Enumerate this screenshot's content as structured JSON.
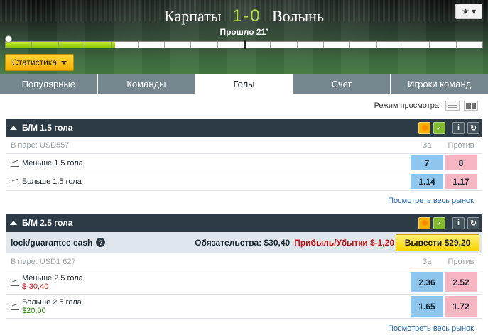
{
  "match": {
    "home_team": "Карпаты",
    "away_team": "Волынь",
    "score": "1-0",
    "elapsed": "Прошло 21’",
    "progress": 0.23,
    "fav_label": "★ ▾"
  },
  "stats_button": "Статистика",
  "tabs": [
    {
      "label": "Популярные",
      "active": false
    },
    {
      "label": "Команды",
      "active": false
    },
    {
      "label": "Голы",
      "active": true
    },
    {
      "label": "Счет",
      "active": false
    },
    {
      "label": "Игроки команд",
      "active": false
    }
  ],
  "view_mode_label": "Режим просмотра:",
  "markets": [
    {
      "title": "Б/М 1.5 гола",
      "matched": "В паре: USD557",
      "back_header": "За",
      "lay_header": "Против",
      "selections": [
        {
          "name": "Меньше 1.5 гола",
          "back": "7",
          "lay": "8"
        },
        {
          "name": "Больше 1.5 гола",
          "back": "1.14",
          "lay": "1.17"
        }
      ],
      "full_market_link": "Посмотреть весь рынок"
    },
    {
      "title": "Б/М 2.5 гола",
      "cashout": {
        "label": "lock/guarantee cash",
        "liability": "Обязательства: $30,40",
        "profit_loss": "Прибыль/Убытки $-1,20",
        "button": "Вывести $29,20"
      },
      "matched": "В паре: USD1 627",
      "back_header": "За",
      "lay_header": "Против",
      "selections": [
        {
          "name": "Меньше 2.5 гола",
          "pl": "$-30,40",
          "back": "2.36",
          "lay": "2.52"
        },
        {
          "name": "Больше 2.5 гола",
          "pl": "$20,00",
          "back": "1.65",
          "lay": "1.72"
        }
      ],
      "full_market_link": "Посмотреть весь рынок"
    }
  ],
  "colors": {
    "back": "#8ec6ed",
    "lay": "#f7b7c2",
    "header": "#2c3b45",
    "tab_inactive": "#75868f",
    "accent_yellow": "#f7d400",
    "negative": "#c01818",
    "positive": "#2e7d12"
  }
}
